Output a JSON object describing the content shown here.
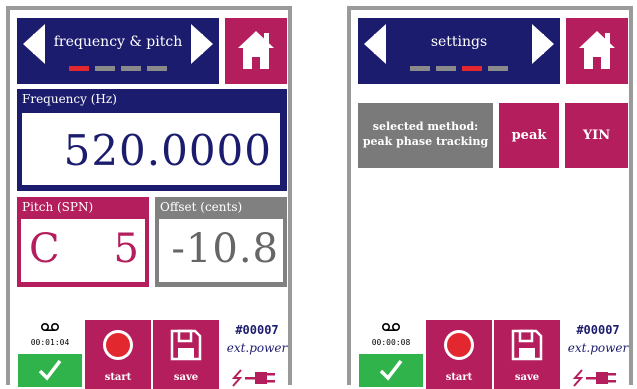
{
  "colors": {
    "navy": "#1c1c6e",
    "crimson": "#b41e5c",
    "gray": "#808080",
    "green": "#2fb34a",
    "red": "#e2282e"
  },
  "screen1": {
    "title": "frequency & pitch",
    "frequency_label": "Frequency (Hz)",
    "frequency_value": "520.0000",
    "pitch_label": "Pitch (SPN)",
    "pitch_note": "C",
    "pitch_octave": "5",
    "offset_label": "Offset (cents)",
    "offset_value": "-10.8",
    "record_time": "00:01:04",
    "start_label": "start",
    "save_label": "save",
    "record_number": "#00007",
    "power_label": "ext.power",
    "page_indicator": {
      "count": 4,
      "active": 1
    }
  },
  "screen2": {
    "title": "settings",
    "method_line1": "selected method:",
    "method_line2": "peak phase tracking",
    "option_peak": "peak",
    "option_yin": "YIN",
    "record_time": "00:00:08",
    "start_label": "start",
    "save_label": "save",
    "record_number": "#00007",
    "power_label": "ext.power",
    "page_indicator": {
      "count": 4,
      "active": 3
    }
  },
  "icons": [
    "arrow-left-icon",
    "arrow-right-icon",
    "home-icon",
    "tape-icon",
    "check-icon",
    "record-icon",
    "floppy-icon",
    "plug-icon",
    "lightning-icon"
  ]
}
